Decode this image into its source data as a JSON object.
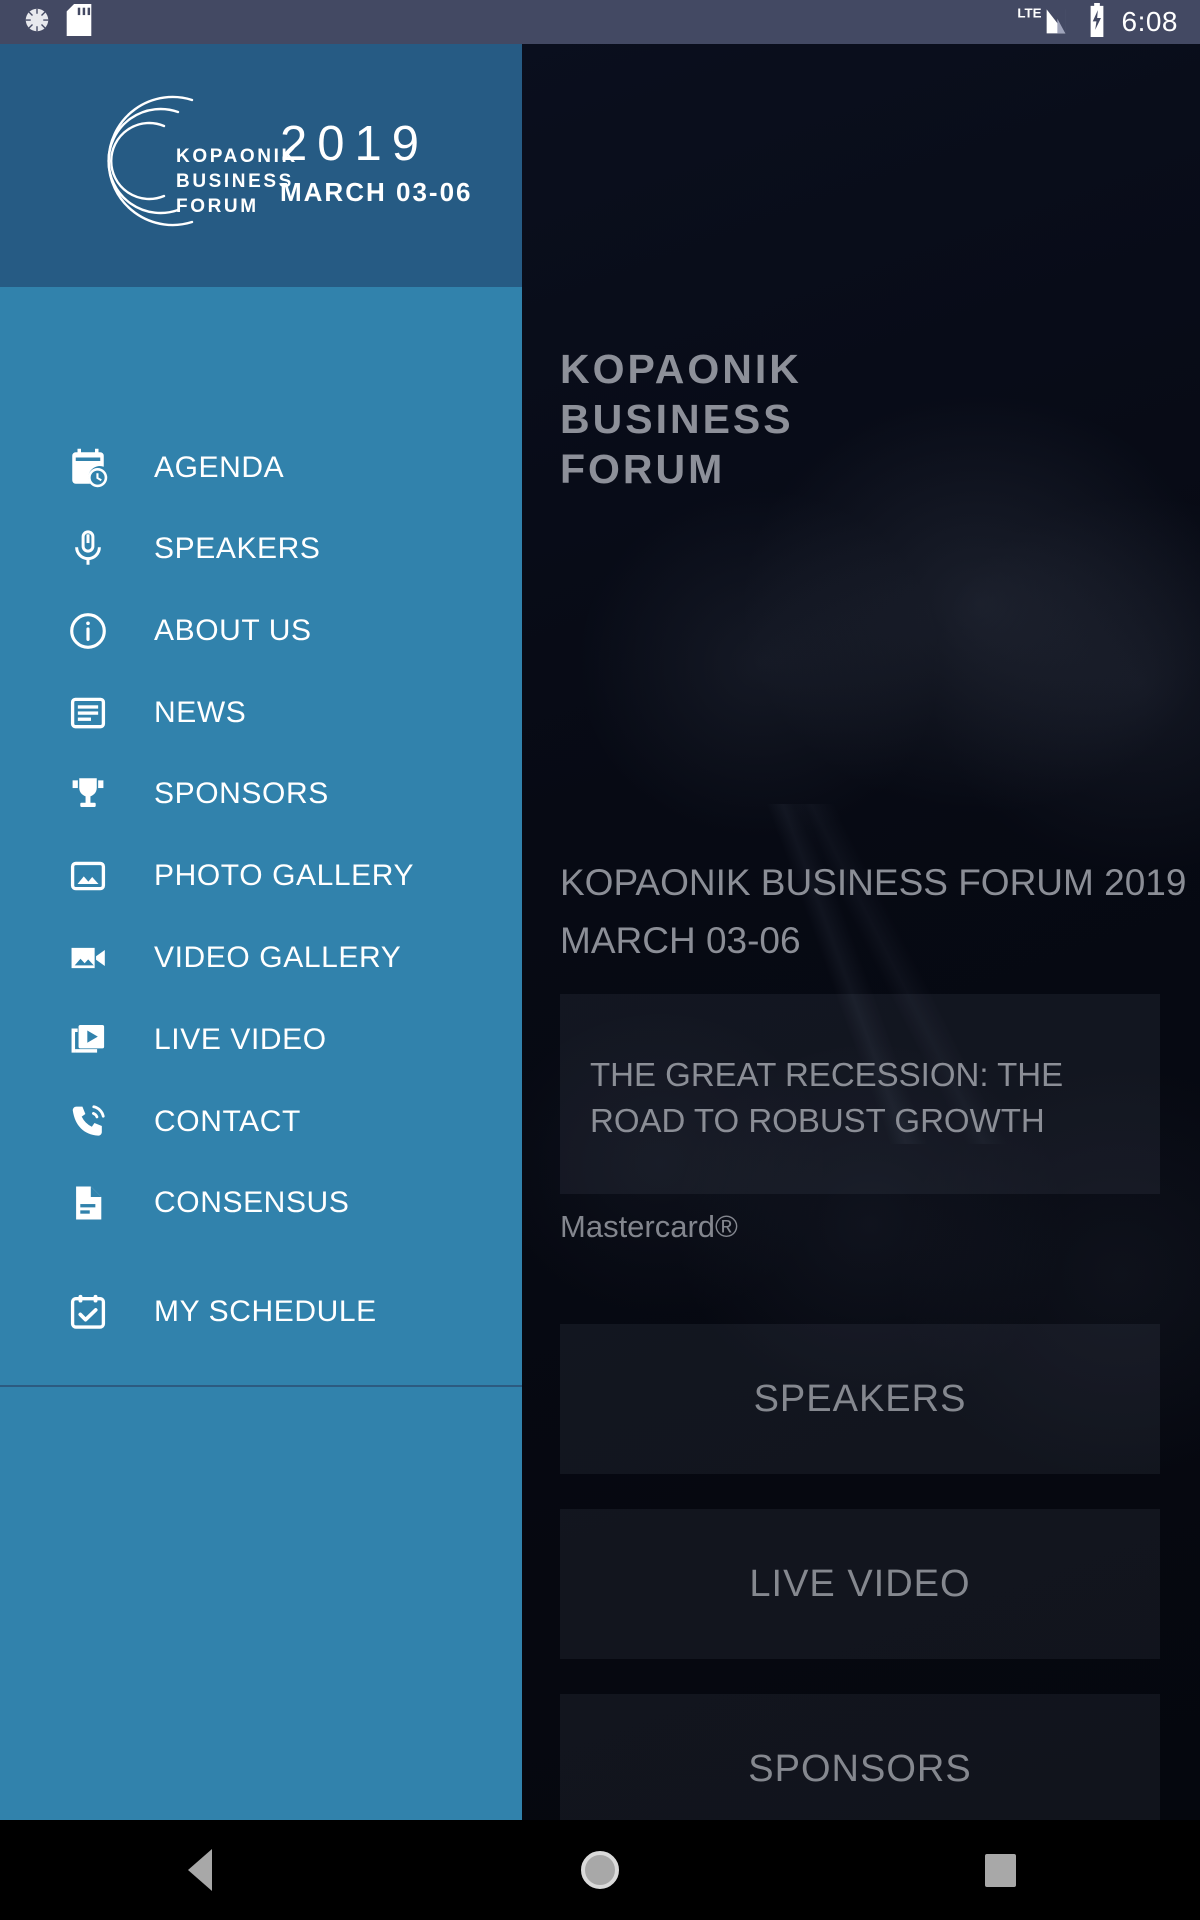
{
  "status_bar": {
    "time": "6:08",
    "icons": [
      "sync-spinner-icon",
      "sd-card-icon",
      "lte-signal-icon",
      "battery-charging-icon"
    ],
    "network_label": "LTE",
    "background_color": "#434963"
  },
  "drawer": {
    "background_color": "#3182ac",
    "header": {
      "background_color": "#265b84",
      "logo_mark": "kopaonik-arc-logo",
      "logo_words": "KOPAONIK\nBUSINESS\nFORUM",
      "year": "2019",
      "dates": "MARCH 03-06"
    },
    "items": [
      {
        "label": "AGENDA",
        "icon": "calendar-clock-icon"
      },
      {
        "label": "SPEAKERS",
        "icon": "microphone-icon"
      },
      {
        "label": "ABOUT US",
        "icon": "info-circle-icon"
      },
      {
        "label": "NEWS",
        "icon": "article-icon"
      },
      {
        "label": "SPONSORS",
        "icon": "trophy-icon"
      },
      {
        "label": "PHOTO GALLERY",
        "icon": "image-icon"
      },
      {
        "label": "VIDEO GALLERY",
        "icon": "video-camera-icon"
      },
      {
        "label": "LIVE VIDEO",
        "icon": "play-frames-icon"
      },
      {
        "label": "CONTACT",
        "icon": "phone-ring-icon"
      },
      {
        "label": "CONSENSUS",
        "icon": "document-icon"
      }
    ],
    "footer_items": [
      {
        "label": "MY SCHEDULE",
        "icon": "calendar-check-icon"
      }
    ]
  },
  "background_screen": {
    "logo_text": "KOPAONIK\nBUSINESS\nFORUM",
    "title_line_1": "KOPAONIK BUSINESS FORUM 2019",
    "title_line_2": "MARCH 03-06",
    "card_text": "THE GREAT RECESSION: THE ROAD TO ROBUST GROWTH",
    "card_subtitle": "Mastercard®",
    "buttons": [
      "SPEAKERS",
      "LIVE VIDEO",
      "SPONSORS"
    ]
  },
  "navigation_bar": {
    "buttons": [
      {
        "name": "back",
        "icon": "triangle-back-icon"
      },
      {
        "name": "home",
        "icon": "circle-home-icon"
      },
      {
        "name": "recents",
        "icon": "square-recents-icon"
      }
    ]
  }
}
